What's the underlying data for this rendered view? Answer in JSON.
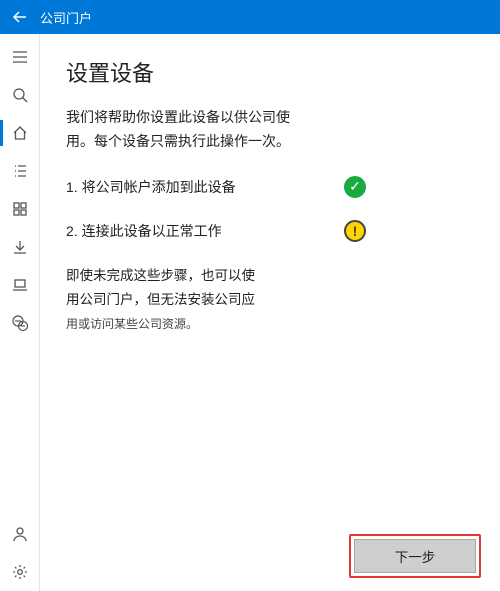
{
  "titlebar": {
    "app_name": "公司门户"
  },
  "sidebar": {
    "items": [
      {
        "name": "menu",
        "glyph": "hamburger"
      },
      {
        "name": "search",
        "glyph": "search"
      },
      {
        "name": "home",
        "glyph": "home",
        "active": true
      },
      {
        "name": "apps",
        "glyph": "list"
      },
      {
        "name": "categories",
        "glyph": "grid"
      },
      {
        "name": "downloads",
        "glyph": "download"
      },
      {
        "name": "devices",
        "glyph": "laptop"
      },
      {
        "name": "support",
        "glyph": "chat"
      }
    ],
    "bottom": [
      {
        "name": "account",
        "glyph": "person"
      },
      {
        "name": "settings",
        "glyph": "gear"
      }
    ]
  },
  "page": {
    "title": "设置设备",
    "intro": "我们将帮助你设置此设备以供公司使用。每个设备只需执行此操作一次。",
    "steps": [
      {
        "label": "1. 将公司帐户添加到此设备",
        "status": "ok"
      },
      {
        "label": "2. 连接此设备以正常工作",
        "status": "warn"
      }
    ],
    "note_line1": "即使未完成这些步骤，也可以使",
    "note_line2": "用公司门户，但无法安装公司应",
    "note_small": "用或访问某些公司资源。",
    "next_label": "下一步"
  },
  "icons": {
    "ok_char": "✓",
    "warn_char": "!"
  }
}
